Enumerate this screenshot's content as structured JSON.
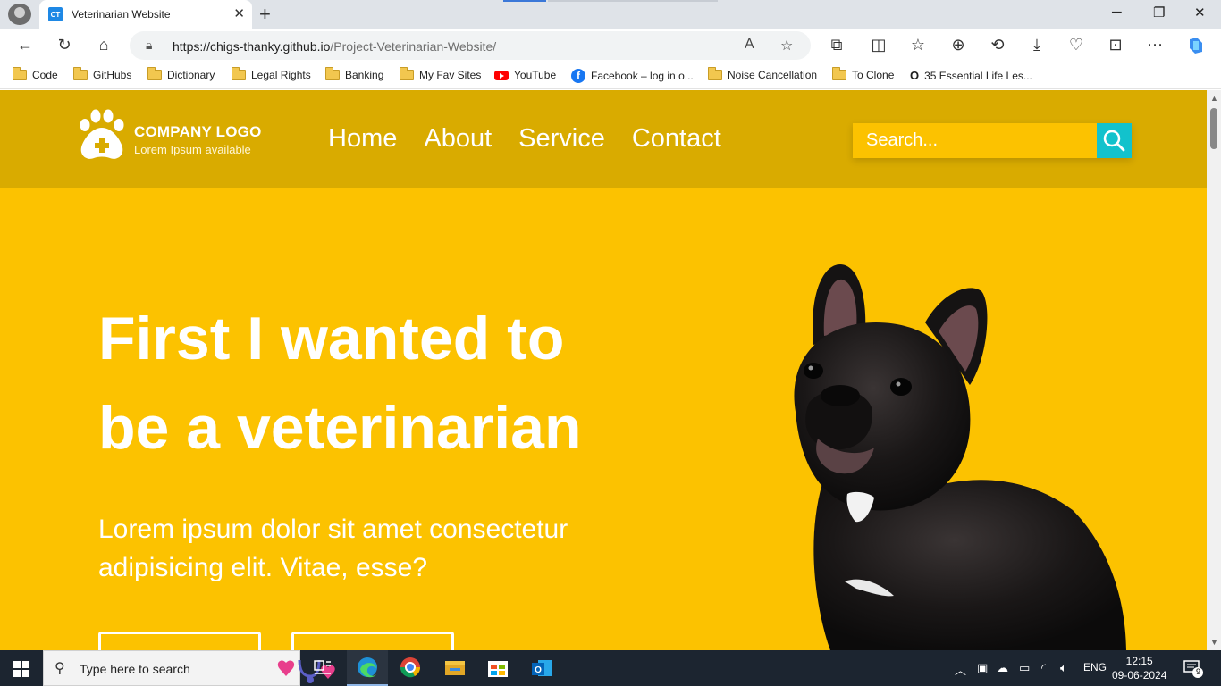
{
  "browser": {
    "tab": {
      "favicon_text": "CT",
      "title": "Veterinarian Website"
    },
    "address": {
      "host": "https://chigs-thanky.github.io",
      "path": "/Project-Veterinarian-Website/"
    },
    "bookmarks": [
      {
        "label": "Code",
        "icon": "folder-icon"
      },
      {
        "label": "GitHubs",
        "icon": "folder-icon"
      },
      {
        "label": "Dictionary",
        "icon": "folder-icon"
      },
      {
        "label": "Legal Rights",
        "icon": "folder-icon"
      },
      {
        "label": "Banking",
        "icon": "folder-icon"
      },
      {
        "label": "My Fav Sites",
        "icon": "folder-icon"
      },
      {
        "label": "YouTube",
        "icon": "youtube-icon"
      },
      {
        "label": "Facebook – log in o...",
        "icon": "facebook-icon"
      },
      {
        "label": "Noise Cancellation",
        "icon": "folder-icon"
      },
      {
        "label": "To Clone",
        "icon": "folder-icon"
      },
      {
        "label": "35 Essential Life Les...",
        "icon": "o-letter-icon"
      }
    ]
  },
  "site": {
    "logo": {
      "title": "COMPANY LOGO",
      "subtitle": "Lorem Ipsum available"
    },
    "nav": [
      "Home",
      "About",
      "Service",
      "Contact"
    ],
    "search": {
      "placeholder": "Search..."
    },
    "hero": {
      "title_line1": "First I wanted to",
      "title_line2": "be a veterinarian",
      "subtitle": "Lorem ipsum dolor sit amet consectetur adipisicing elit. Vitae, esse?"
    },
    "colors": {
      "background": "#fcc200",
      "header": "#d9ab00",
      "search_button": "#12c2cc"
    }
  },
  "taskbar": {
    "search_text": "Type here to search",
    "language": "ENG",
    "time": "12:15",
    "date": "09-06-2024",
    "notification_count": "9"
  }
}
